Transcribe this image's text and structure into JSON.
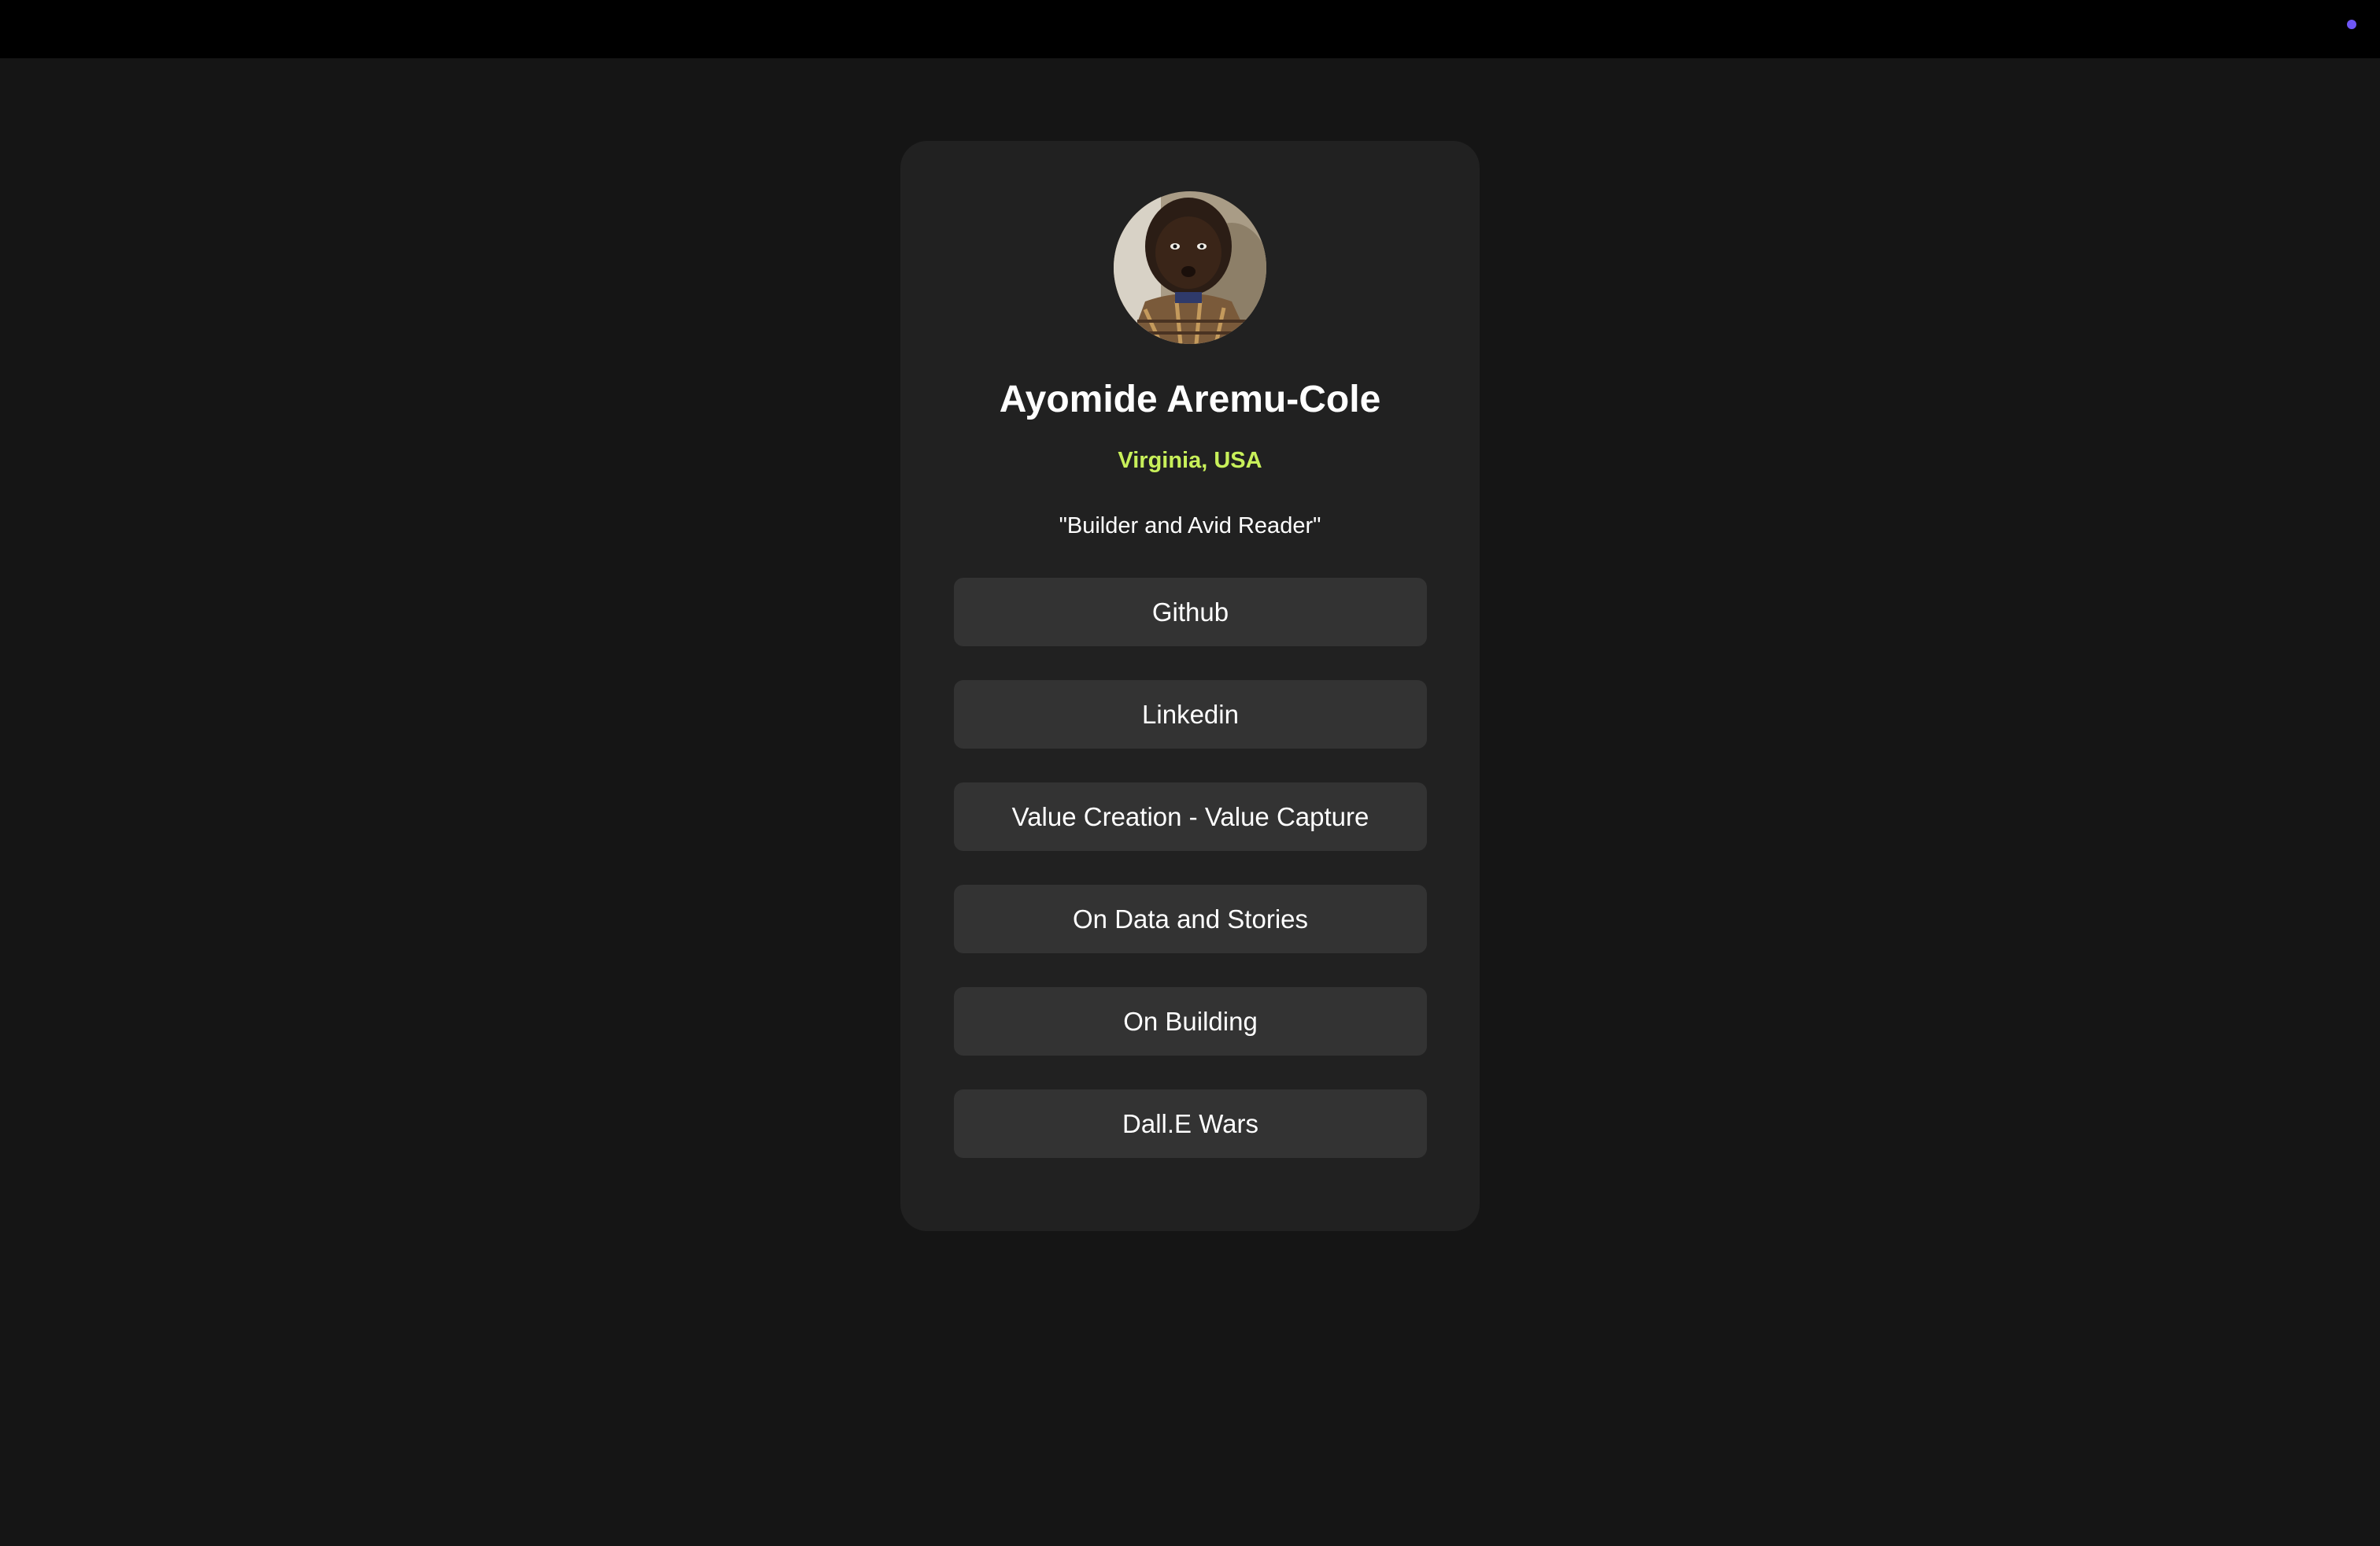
{
  "profile": {
    "name": "Ayomide Aremu-Cole",
    "location": "Virginia, USA",
    "tagline": "\"Builder and Avid Reader\""
  },
  "links": [
    {
      "label": "Github"
    },
    {
      "label": "Linkedin"
    },
    {
      "label": "Value Creation - Value Capture"
    },
    {
      "label": "On Data and Stories"
    },
    {
      "label": "On Building"
    },
    {
      "label": "Dall.E Wars"
    }
  ],
  "colors": {
    "background": "#151515",
    "card": "#212121",
    "button": "#333333",
    "accent": "#c8f05a",
    "topbar_dot": "#6e56f5"
  }
}
